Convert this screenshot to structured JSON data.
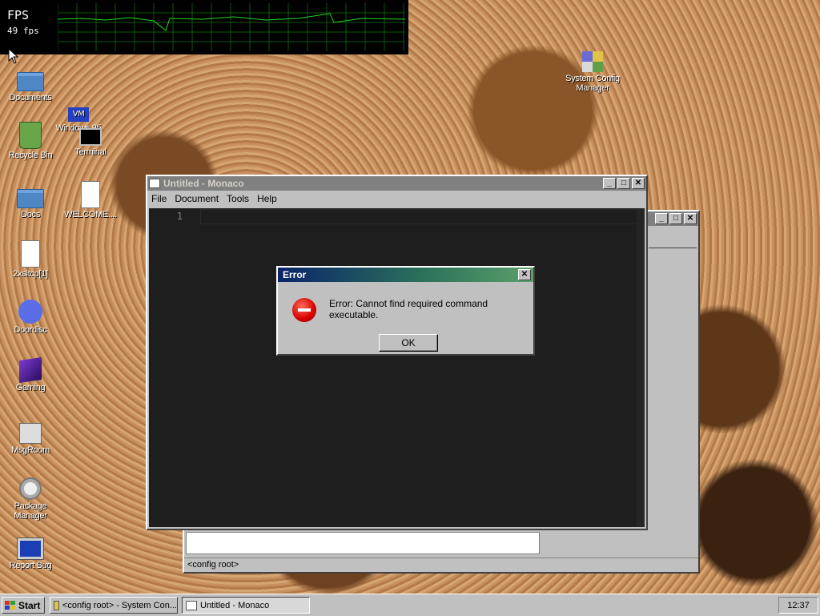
{
  "fps_meter": {
    "label": "FPS",
    "value": "49 fps"
  },
  "desktop_icons": [
    {
      "label": "Documents"
    },
    {
      "label": "Recycle Bin"
    },
    {
      "label": "Windows 95"
    },
    {
      "label": "Terminal"
    },
    {
      "label": "Docs"
    },
    {
      "label": "WELCOME...."
    },
    {
      "label": "2xsitcp[1]"
    },
    {
      "label": "Doordisc"
    },
    {
      "label": "Gaming"
    },
    {
      "label": "MsgRoom"
    },
    {
      "label": "Package Manager"
    },
    {
      "label": "Report Bug"
    },
    {
      "label": "System Config Manager"
    }
  ],
  "vm_badge": "VM",
  "editor_window": {
    "title": "Untitled - Monaco",
    "menu": [
      "File",
      "Document",
      "Tools",
      "Help"
    ],
    "line_number": "1"
  },
  "config_window": {
    "status": "<config root>"
  },
  "error_dialog": {
    "title": "Error",
    "message": "Error: Cannot find required command executable.",
    "ok_label": "OK"
  },
  "taskbar": {
    "start_label": "Start",
    "tasks": [
      "<config root> - System Con...",
      "Untitled - Monaco"
    ],
    "clock": "12:37"
  },
  "window_controls": {
    "minimize": "_",
    "maximize": "□",
    "close": "✕"
  }
}
